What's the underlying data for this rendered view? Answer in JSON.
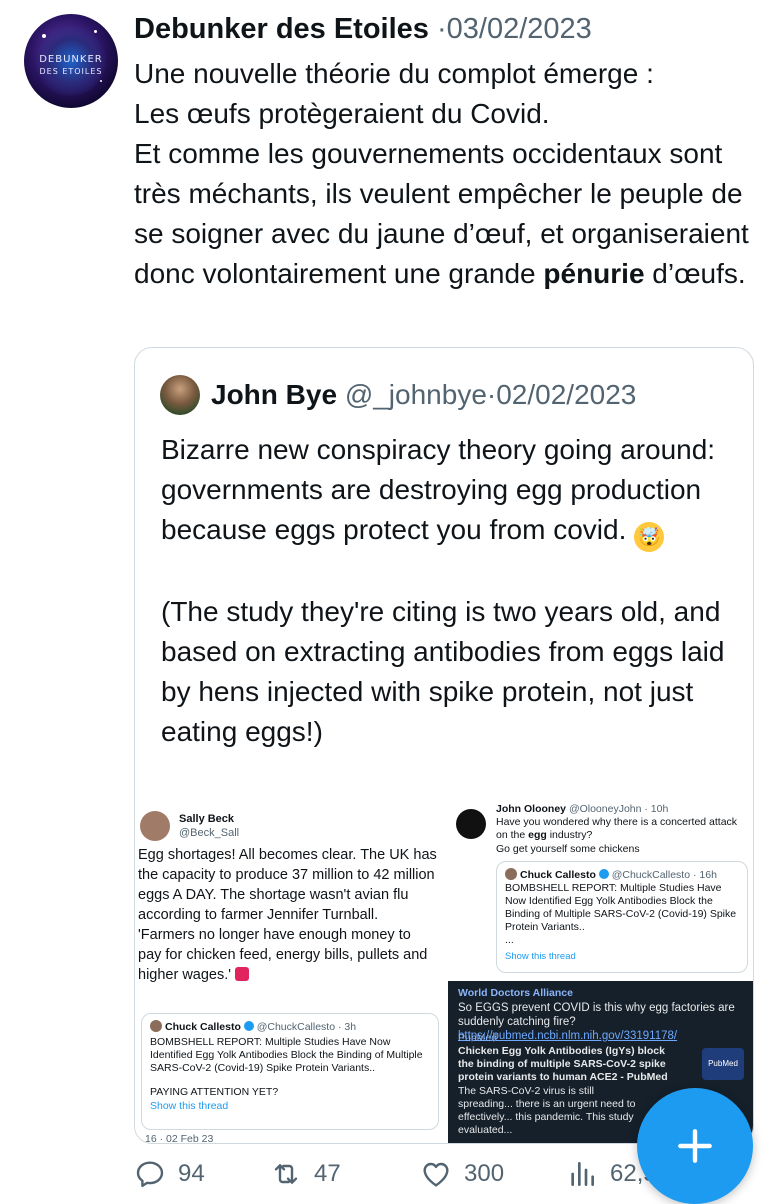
{
  "tweet": {
    "author_name": "Debunker des Etoiles",
    "separator": "·",
    "date": "03/02/2023",
    "avatar_text_line1": "DEBUNKER",
    "avatar_text_line2": "DES ETOILES",
    "text_line1": "Une nouvelle théorie du complot émerge :",
    "text_line2": "Les œufs protègeraient du Covid.",
    "text_line3": "Et comme les gouvernements occidentaux sont très méchants, ils veulent empêcher le peuple de se soigner avec du jaune d’œuf, et organiseraient donc volontairement une grande ",
    "text_bold": "pénurie",
    "text_end": " d’œufs."
  },
  "quote": {
    "author_name": "John Bye",
    "handle": "@_johnbye",
    "separator": "·",
    "date": "02/02/2023",
    "paragraph1": "Bizarre new conspiracy theory going around: governments are destroying egg production because eggs protect you from covid.",
    "emoji": "🤯",
    "paragraph2": "(The study they're citing is two years old, and based on extracting antibodies from eggs laid by hens injected with spike protein, not just eating eggs!)"
  },
  "media": {
    "sally": {
      "name": "Sally Beck",
      "handle": "@Beck_Sall",
      "text": "Egg shortages! All becomes clear. The UK has the capacity to produce 37 million to 42 million eggs A DAY. The shortage wasn't avian flu according to farmer Jennifer Turnball. 'Farmers no longer have enough money to pay for chicken feed, energy bills, pullets and higher wages.'",
      "card_name": "Chuck Callesto",
      "card_handle": "@ChuckCallesto · 3h",
      "card_text": "BOMBSHELL REPORT: Multiple Studies Have Now Identified Egg Yolk Antibodies Block the Binding of Multiple SARS-CoV-2 (Covid-19) Spike Protein Variants..",
      "card_text2": "PAYING ATTENTION YET?",
      "card_link": "Show this thread",
      "footer": "16 · 02 Feb 23"
    },
    "olooney": {
      "name": "John Olooney",
      "handle": "@OlooneyJohn · 10h",
      "text_a": "Have you wondered why there is a concerted attack on the ",
      "text_bold": "egg",
      "text_b": " industry?",
      "text2": "Go get yourself some chickens",
      "card_name": "Chuck Callesto",
      "card_handle": "@ChuckCallesto · 16h",
      "card_text": "BOMBSHELL REPORT: Multiple Studies Have Now Identified Egg Yolk Antibodies Block the Binding of Multiple SARS-CoV-2 (Covid-19) Spike Protein Variants..",
      "card_more": "...",
      "card_link": "Show this thread"
    },
    "wda": {
      "name": "World Doctors Alliance",
      "text": "So EGGS prevent COVID is this why egg factories are suddenly catching fire? ",
      "link": "https://pubmed.ncbi.nlm.nih.gov/33191178/",
      "source": "PubMed",
      "card_title": "Chicken Egg Yolk Antibodies (IgYs) block the binding of multiple SARS-CoV-2 spike protein variants to human ACE2 - PubMed",
      "card_text": "The SARS-CoV-2 virus is still spreading... there is an urgent need to effectively... this pandemic. This study evaluated...",
      "logo_text": "PubMed"
    }
  },
  "actions": {
    "replies": "94",
    "retweets": "47",
    "likes": "300",
    "views": "62,5"
  }
}
